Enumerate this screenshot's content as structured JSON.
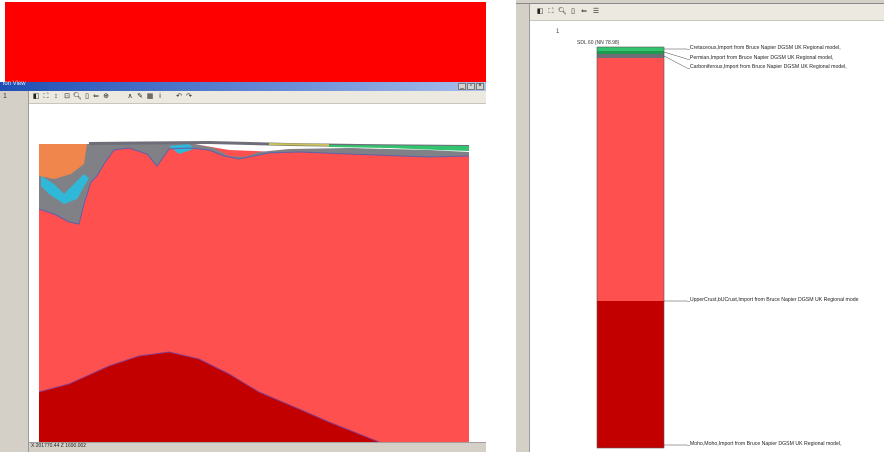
{
  "left_window": {
    "title": "ion View",
    "sidebar_mark": "1",
    "toolbar_icons": [
      "select-icon",
      "fit-icon",
      "pan-icon",
      "zoom-box-icon",
      "zoom-icon",
      "measure-icon",
      "back-icon",
      "zoom-in-icon",
      "line-icon",
      "edit-icon",
      "grid-icon",
      "info-icon",
      "arrow-left-icon",
      "arrow-right-icon"
    ],
    "status": "X 201770.44 Z 1690.002",
    "cross_section": {
      "layers": [
        {
          "name": "Upper crust",
          "color": "#ff5050"
        },
        {
          "name": "Moho",
          "color": "#c30000"
        },
        {
          "name": "Basin fill",
          "color": "#808087"
        },
        {
          "name": "Orange unit",
          "color": "#f0864b"
        },
        {
          "name": "Cyan unit",
          "color": "#2fb8d8"
        },
        {
          "name": "Green unit",
          "color": "#32c36e"
        }
      ]
    }
  },
  "right_window": {
    "corner_mark": "1",
    "well_label": "SDL 60  (NN 78.98)",
    "toolbar_icons": [
      "select-icon",
      "fit-icon",
      "zoom-icon",
      "marker-icon",
      "back-icon",
      "layers-icon"
    ],
    "layers": [
      {
        "label": "_Cretaceous,Import from Bruce Napier DGSM UK Regional model,",
        "color": "#32c36e"
      },
      {
        "label": "_Permian,Import from Bruce Napier DGSM UK Regional model,",
        "color": "#1f9a4f"
      },
      {
        "label": "_Carboniferous,Import from Bruce Napier DGSM UK Regional model,",
        "color": "#6e6e78"
      },
      {
        "label": "_UpperCrust,bUCrust,Import from Bruce Napier DGSM UK Regional mode",
        "color": "#ff5050"
      },
      {
        "label": "_Moho,Moho,Import from Bruce Napier DGSM UK Regional model,",
        "color": "#c30000"
      }
    ]
  }
}
